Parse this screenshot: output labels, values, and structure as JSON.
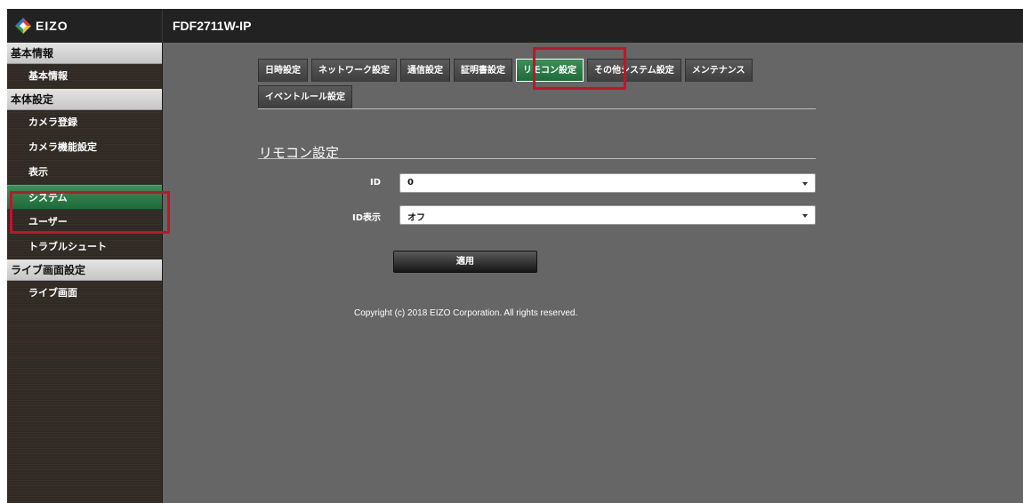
{
  "header": {
    "logo_text": "EIZO",
    "model": "FDF2711W-IP"
  },
  "sidebar": {
    "sections": [
      {
        "title": "基本情報",
        "items": [
          {
            "label": "基本情報"
          }
        ]
      },
      {
        "title": "本体設定",
        "items": [
          {
            "label": "カメラ登録"
          },
          {
            "label": "カメラ機能設定"
          },
          {
            "label": "表示"
          },
          {
            "label": "システム",
            "active": true
          },
          {
            "label": "ユーザー"
          },
          {
            "label": "トラブルシュート"
          }
        ]
      },
      {
        "title": "ライブ画面設定",
        "items": [
          {
            "label": "ライブ画面"
          }
        ]
      }
    ]
  },
  "tabs": [
    {
      "label": "日時設定"
    },
    {
      "label": "ネットワーク設定"
    },
    {
      "label": "通信設定"
    },
    {
      "label": "証明書設定"
    },
    {
      "label": "リモコン設定",
      "active": true
    },
    {
      "label": "その他システム設定"
    },
    {
      "label": "メンテナンス"
    },
    {
      "label": "イベントルール設定"
    }
  ],
  "main": {
    "section_title": "リモコン設定",
    "fields": [
      {
        "label": "ID",
        "value": "0"
      },
      {
        "label": "ID表示",
        "value": "オフ"
      }
    ],
    "apply_label": "適用",
    "copyright": "Copyright (c) 2018 EIZO Corporation. All rights reserved."
  },
  "colors": {
    "accent_green": "#2a7a45",
    "highlight_red": "#c8102e",
    "background": "#666666",
    "topbar": "#222222"
  }
}
